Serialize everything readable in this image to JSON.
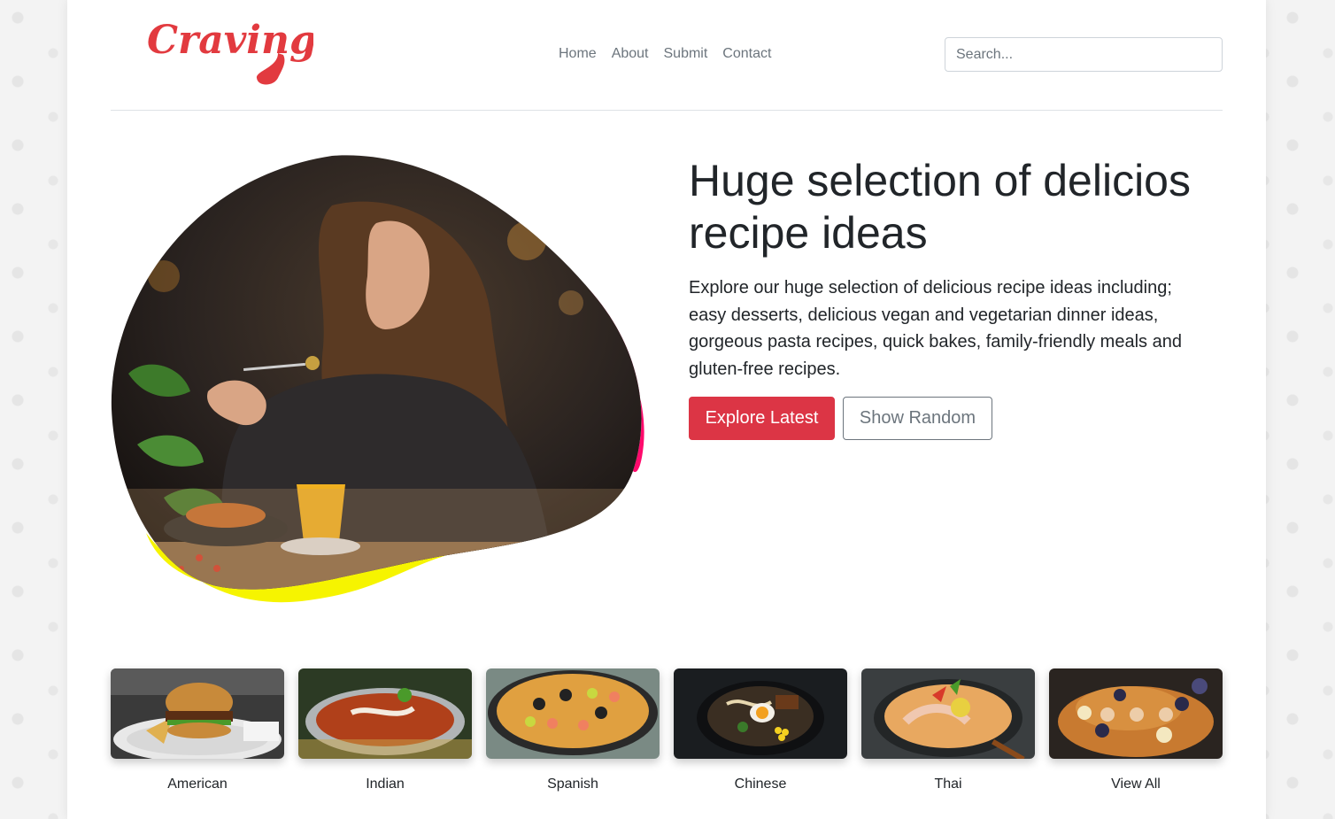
{
  "header": {
    "logo_text": "Cravings",
    "nav": [
      "Home",
      "About",
      "Submit",
      "Contact"
    ],
    "search_placeholder": "Search..."
  },
  "hero": {
    "title": "Huge selection of delicios recipe ideas",
    "description": "Explore our huge selection of delicious recipe ideas including; easy desserts, delicious vegan and vegetarian dinner ideas, gorgeous pasta recipes, quick bakes, family-friendly meals and gluten-free recipes.",
    "primary_button": "Explore Latest",
    "secondary_button": "Show Random"
  },
  "categories": [
    "American",
    "Indian",
    "Spanish",
    "Chinese",
    "Thai",
    "View All"
  ],
  "colors": {
    "brand": "#dc3545",
    "blob_pink": "#ff0a6c",
    "blob_yellow": "#f6f400",
    "muted": "#6c757d"
  }
}
